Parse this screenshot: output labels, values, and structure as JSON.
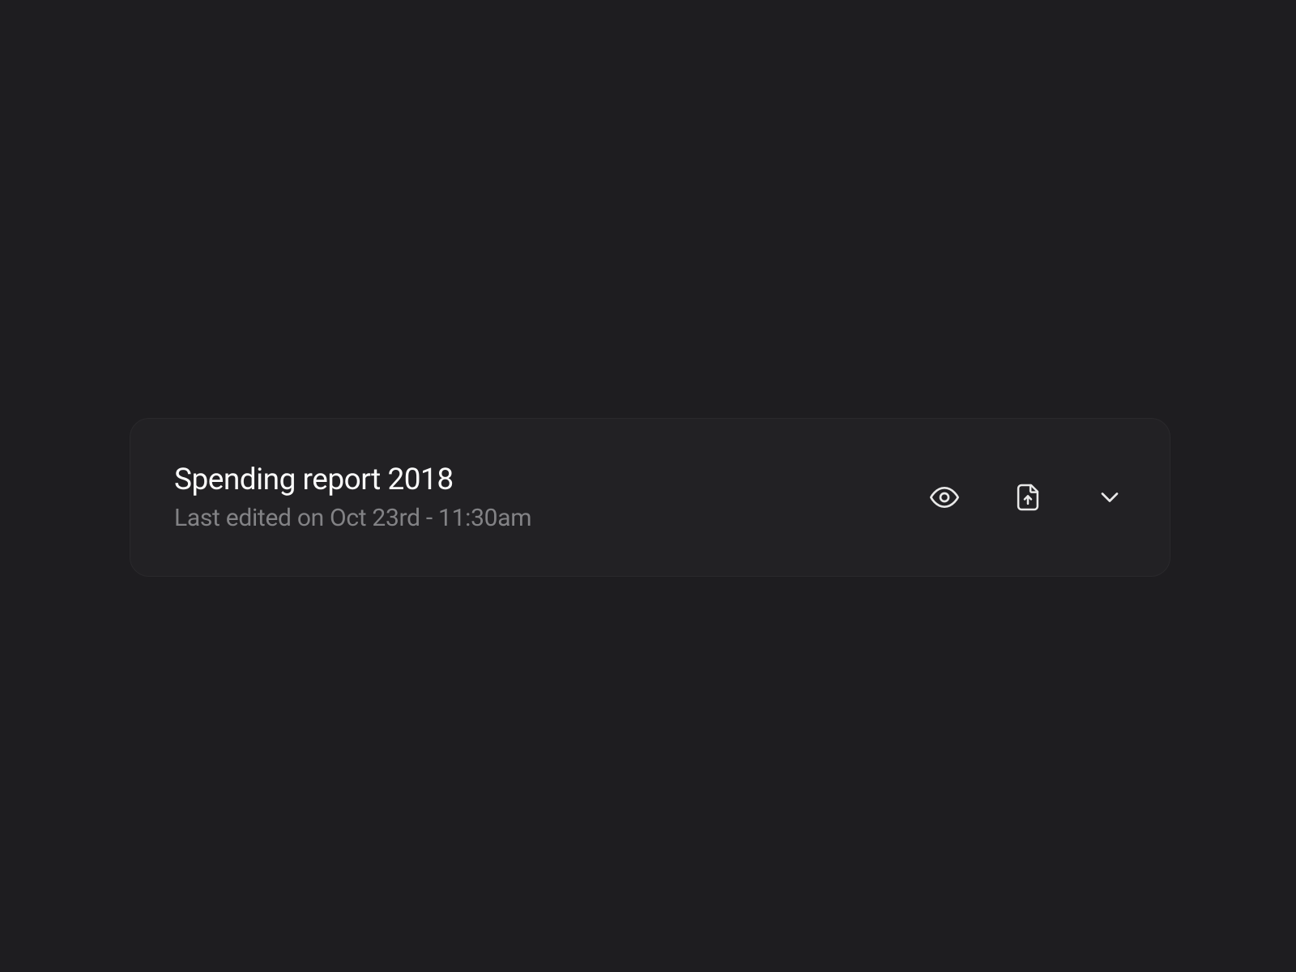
{
  "card": {
    "title": "Spending report 2018",
    "subtitle": "Last edited on Oct 23rd - 11:30am"
  }
}
